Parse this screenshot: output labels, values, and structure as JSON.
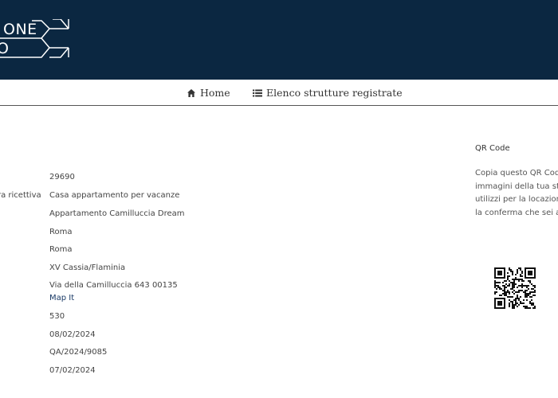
{
  "header": {
    "logo_line1": "ONE",
    "logo_line2": "O"
  },
  "nav": {
    "home_icon": "home-icon",
    "home_label": "Home",
    "list_icon": "list-icon",
    "list_label": "Elenco strutture registrate"
  },
  "details": {
    "partial_label": "ra ricettiva",
    "values": [
      "29690",
      "Casa appartamento per vacanze",
      "Appartamento Camilluccia Dream",
      "Roma",
      "Roma",
      "XV Cassia/Flaminia",
      "Via della Camilluccia 643 00135",
      "Map It",
      "530",
      "08/02/2024",
      "QA/2024/9085",
      "07/02/2024"
    ]
  },
  "qr": {
    "title": "QR Code",
    "lines": [
      "Copia questo QR Code",
      "immagini della tua stru",
      "utilizzi per la locazione",
      "la conferma che sei au"
    ]
  }
}
